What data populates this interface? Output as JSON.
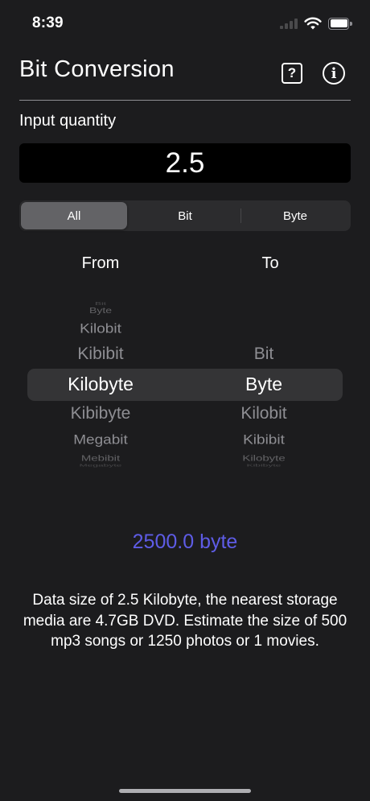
{
  "status_bar": {
    "time": "8:39"
  },
  "header": {
    "title": "Bit Conversion",
    "help_icon": "question-mark-square-icon",
    "info_icon": "info-circle-icon"
  },
  "input": {
    "label": "Input quantity",
    "value": "2.5"
  },
  "segments": {
    "items": [
      "All",
      "Bit",
      "Byte"
    ],
    "selected": "All"
  },
  "columns": {
    "from_label": "From",
    "to_label": "To"
  },
  "picker": {
    "from_items": [
      "Bit",
      "Byte",
      "Kilobit",
      "Kibibit",
      "Kilobyte",
      "Kibibyte",
      "Megabit",
      "Mebibit",
      "Megabyte"
    ],
    "from_selected": "Kilobyte",
    "to_items": [
      "Bit",
      "Byte",
      "Kilobit",
      "Kibibit",
      "Kilobyte",
      "Kibibyte"
    ],
    "to_selected": "Byte"
  },
  "result": "2500.0 byte",
  "description": "Data size of 2.5 Kilobyte, the nearest storage media are 4.7GB DVD. Estimate the size of 500 mp3 songs or 1250 photos or 1 movies.",
  "colors": {
    "background": "#1c1c1e",
    "result_accent": "#5e5ce6",
    "segment_selected": "#636366",
    "picker_highlight": "#343436"
  }
}
